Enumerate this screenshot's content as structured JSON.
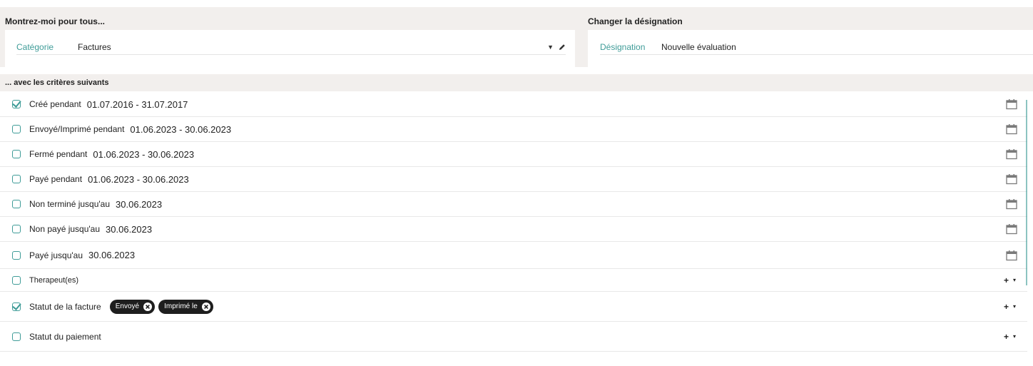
{
  "show_for_all": {
    "title": "Montrez-moi pour tous...",
    "category_label": "Catégorie",
    "category_value": "Factures"
  },
  "change_designation": {
    "title": "Changer la désignation",
    "designation_label": "Désignation",
    "designation_value": "Nouvelle évaluation"
  },
  "criteria": {
    "title": "... avec les critères suivants",
    "date_rows": [
      {
        "label": "Créé pendant",
        "value": "01.07.2016 - 31.07.2017",
        "checked": true
      },
      {
        "label": "Envoyé/Imprimé pendant",
        "value": "01.06.2023 - 30.06.2023",
        "checked": false
      },
      {
        "label": "Fermé pendant",
        "value": "01.06.2023 - 30.06.2023",
        "checked": false
      },
      {
        "label": "Payé pendant",
        "value": "01.06.2023 - 30.06.2023",
        "checked": false
      },
      {
        "label": "Non terminé jusqu'au",
        "value": "30.06.2023",
        "checked": false
      },
      {
        "label": "Non payé jusqu'au",
        "value": "30.06.2023",
        "checked": false
      },
      {
        "label": "Payé jusqu'au",
        "value": "30.06.2023",
        "checked": false
      }
    ],
    "therapists": {
      "label": "Therapeut(es)",
      "checked": false
    },
    "invoice_status": {
      "label": "Statut de la facture",
      "checked": true,
      "tags": [
        "Envoyé",
        "Imprimé le"
      ]
    },
    "payment_status": {
      "label": "Statut du paiement",
      "checked": false
    },
    "add_symbol": "+",
    "caret_symbol": "▾"
  },
  "colors": {
    "accent": "#3f9c98",
    "panel_bg": "#f2efed",
    "tag_bg": "#1e1e1e"
  },
  "icons": {
    "calendar": "calendar-icon",
    "edit": "pencil-icon",
    "remove_tag": "close-circle-icon"
  }
}
